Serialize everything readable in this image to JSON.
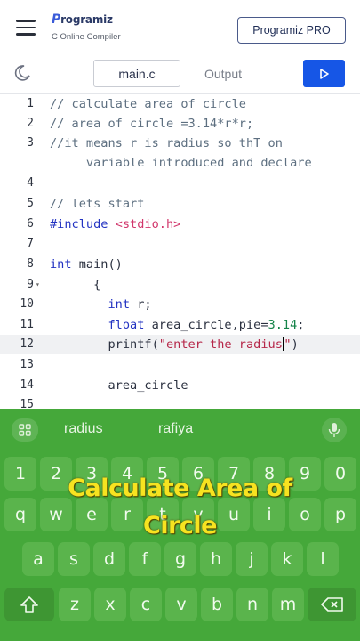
{
  "header": {
    "logo_name": "rogramiz",
    "logo_initial": "P",
    "logo_subtitle": "C Online Compiler",
    "pro_button": "Programiz PRO"
  },
  "toolbar": {
    "tab_file": "main.c",
    "tab_output": "Output",
    "run_icon": "play-icon",
    "theme_icon": "moon-icon"
  },
  "editor": {
    "active_line": 12,
    "lines": [
      {
        "num": "1",
        "text": "// calculate area of circle"
      },
      {
        "num": "2",
        "text": "// area of circle =3.14*r*r;"
      },
      {
        "num": "3",
        "text": "//it means r is radius so thT on"
      },
      {
        "num": "",
        "text": "     variable introduced and declare"
      },
      {
        "num": "4",
        "text": ""
      },
      {
        "num": "5",
        "text": "// lets start"
      },
      {
        "num": "6",
        "text": "#include <stdio.h>"
      },
      {
        "num": "7",
        "text": ""
      },
      {
        "num": "8",
        "text": "int main()"
      },
      {
        "num": "9",
        "text": "      {"
      },
      {
        "num": "10",
        "text": "        int r;"
      },
      {
        "num": "11",
        "text": "        float area_circle,pie=3.14;"
      },
      {
        "num": "12",
        "text": "        printf(\"enter the radius\")"
      },
      {
        "num": "13",
        "text": ""
      },
      {
        "num": "14",
        "text": "        area_circle"
      },
      {
        "num": "15",
        "text": ""
      }
    ]
  },
  "keyboard": {
    "suggestions": [
      "radius",
      "rafiya"
    ],
    "row_numbers": [
      "1",
      "2",
      "3",
      "4",
      "5",
      "6",
      "7",
      "8",
      "9",
      "0"
    ],
    "row_top": [
      "q",
      "w",
      "e",
      "r",
      "t",
      "y",
      "u",
      "i",
      "o",
      "p"
    ],
    "row_mid": [
      "a",
      "s",
      "d",
      "f",
      "g",
      "h",
      "j",
      "k",
      "l"
    ],
    "row_bottom": [
      "z",
      "x",
      "c",
      "v",
      "b",
      "n",
      "m"
    ]
  },
  "overlay": {
    "line1": "Calculate Area of",
    "line2": "Circle"
  }
}
